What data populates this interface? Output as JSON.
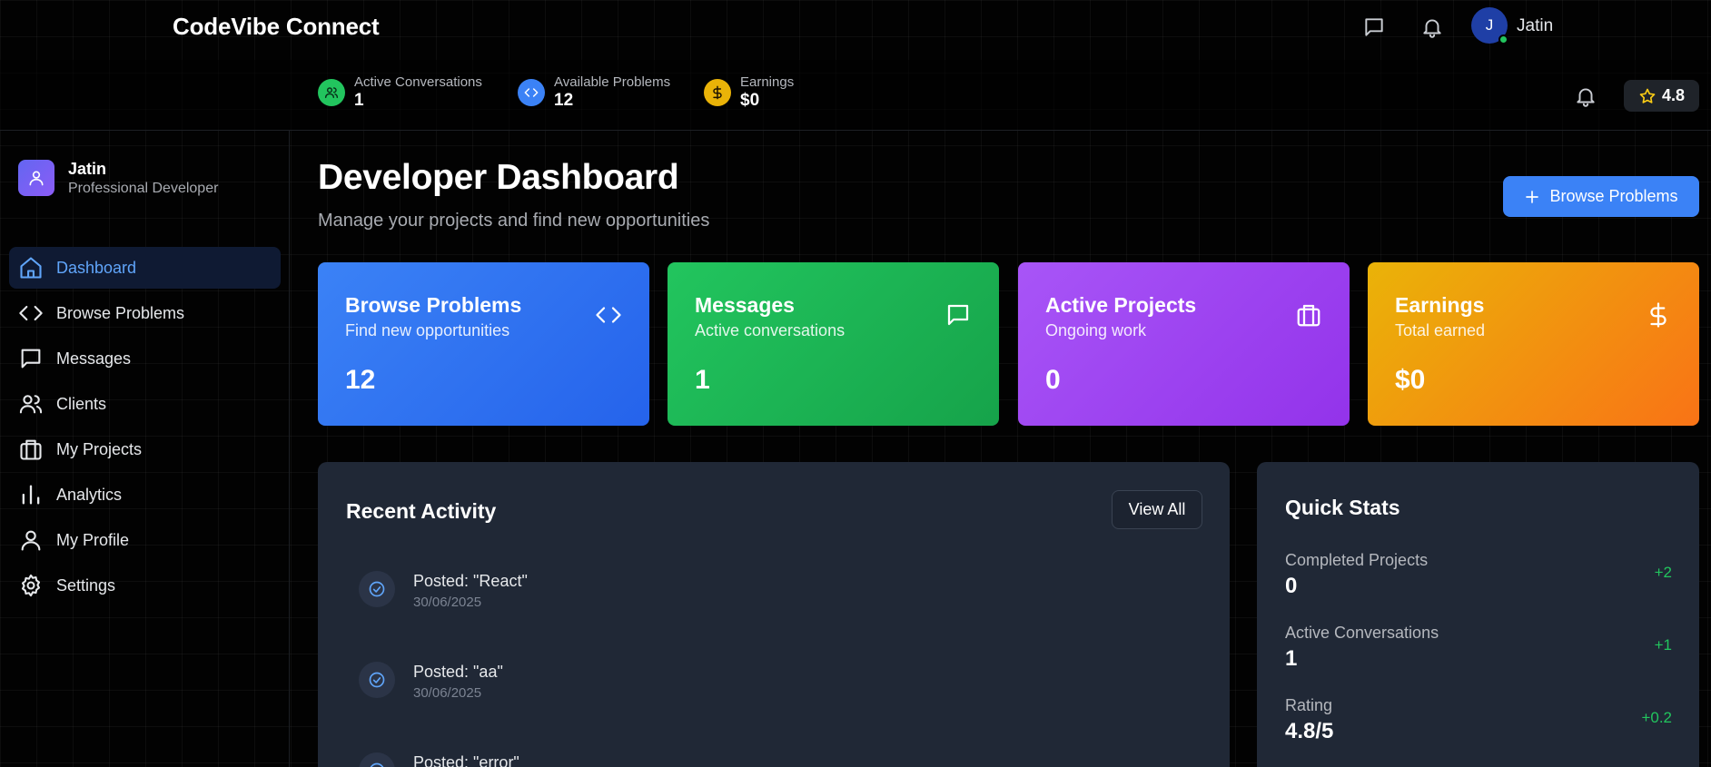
{
  "header": {
    "brand": "CodeVibe Connect",
    "user": {
      "initial": "J",
      "name": "Jatin"
    },
    "icons": [
      "message-icon",
      "bell-icon"
    ]
  },
  "stats_bar": {
    "items": [
      {
        "label": "Active Conversations",
        "value": "1",
        "color": "#22c55e",
        "icon": "users-icon"
      },
      {
        "label": "Available Problems",
        "value": "12",
        "color": "#3b82f6",
        "icon": "code-icon"
      },
      {
        "label": "Earnings",
        "value": "$0",
        "color": "#eab308",
        "icon": "dollar-icon"
      }
    ],
    "rating": "4.8"
  },
  "sidebar": {
    "profile": {
      "name": "Jatin",
      "role": "Professional Developer"
    },
    "items": [
      {
        "label": "Dashboard",
        "icon": "home-icon",
        "active": true
      },
      {
        "label": "Browse Problems",
        "icon": "code-icon"
      },
      {
        "label": "Messages",
        "icon": "message-icon"
      },
      {
        "label": "Clients",
        "icon": "users-icon"
      },
      {
        "label": "My Projects",
        "icon": "briefcase-icon"
      },
      {
        "label": "Analytics",
        "icon": "bar-chart-icon"
      },
      {
        "label": "My Profile",
        "icon": "user-icon"
      },
      {
        "label": "Settings",
        "icon": "settings-icon"
      }
    ]
  },
  "main": {
    "title": "Developer Dashboard",
    "subtitle": "Manage your projects and find new opportunities",
    "primary_button": "Browse Problems",
    "cards": [
      {
        "title": "Browse Problems",
        "subtitle": "Find new opportunities",
        "value": "12",
        "icon": "code-icon",
        "color": "#3b82f6"
      },
      {
        "title": "Messages",
        "subtitle": "Active conversations",
        "value": "1",
        "icon": "message-icon",
        "color": "#22c55e"
      },
      {
        "title": "Active Projects",
        "subtitle": "Ongoing work",
        "value": "0",
        "icon": "briefcase-icon",
        "color": "#a855f7"
      },
      {
        "title": "Earnings",
        "subtitle": "Total earned",
        "value": "$0",
        "icon": "dollar-icon",
        "color": "#f59e0b"
      }
    ],
    "recent_activity": {
      "title": "Recent Activity",
      "view_all": "View All",
      "items": [
        {
          "text": "Posted: \"React\"",
          "date": "30/06/2025"
        },
        {
          "text": "Posted: \"aa\"",
          "date": "30/06/2025"
        },
        {
          "text": "Posted: \"error\"",
          "date": ""
        }
      ]
    },
    "quick_stats": {
      "title": "Quick Stats",
      "items": [
        {
          "label": "Completed Projects",
          "value": "0",
          "change": "+2"
        },
        {
          "label": "Active Conversations",
          "value": "1",
          "change": "+1"
        },
        {
          "label": "Rating",
          "value": "4.8/5",
          "change": "+0.2"
        }
      ]
    }
  }
}
